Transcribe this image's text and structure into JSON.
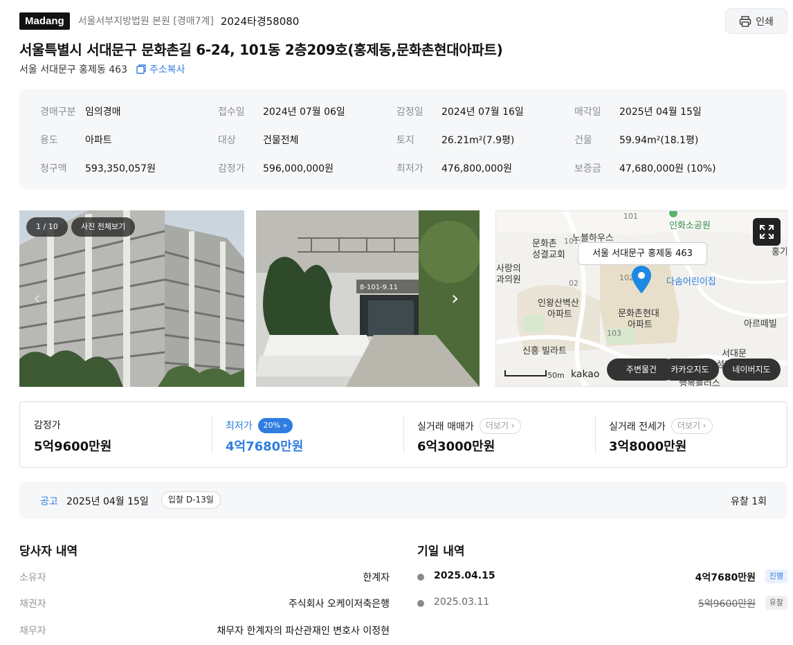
{
  "header": {
    "brand": "Madang",
    "court": "서울서부지방법원 본원 [경매7계]",
    "case_number": "2024타경58080",
    "print_label": "인쇄"
  },
  "address": {
    "full": "서울특별시 서대문구 문화촌길 6-24, 101동 2층209호(홍제동,문화촌현대아파트)",
    "lot": "서울 서대문구 홍제동 463",
    "copy_label": "주소복사"
  },
  "info": [
    {
      "label": "경매구분",
      "value": "임의경매"
    },
    {
      "label": "접수일",
      "value": "2024년 07월 06일"
    },
    {
      "label": "감정일",
      "value": "2024년 07월 16일"
    },
    {
      "label": "매각일",
      "value": "2025년 04월 15일"
    },
    {
      "label": "용도",
      "value": "아파트"
    },
    {
      "label": "대상",
      "value": "건물전체"
    },
    {
      "label": "토지",
      "value": "26.21m²(7.9평)"
    },
    {
      "label": "건물",
      "value": "59.94m²(18.1평)"
    },
    {
      "label": "청구액",
      "value": "593,350,057원"
    },
    {
      "label": "감정가",
      "value": "596,000,000원"
    },
    {
      "label": "최저가",
      "value": "476,800,000원"
    },
    {
      "label": "보증금",
      "value": "47,680,000원 (10%)"
    }
  ],
  "photos": {
    "counter": "1 / 10",
    "view_all": "사진 전체보기",
    "door_sign": "8-101-9.11"
  },
  "map": {
    "bubble": "서울 서대문구 홍제동 463",
    "labels": {
      "hall": "노블하우스",
      "church1": "문화촌",
      "church2": "성결교회",
      "clinic1": "사랑의",
      "clinic2": "과의원",
      "park": "인화소공원",
      "daycare": "다솜어린이집",
      "apt1a": "인왕산벽산",
      "apt1b": "아파트",
      "apt2a": "문화촌현대",
      "apt2b": "아파트",
      "villa": "신흥 빌라트",
      "arte": "아르떼빌",
      "seodaemun1": "서대문",
      "seodaemun2": "성지교회",
      "bottom1": "행복플러스",
      "hong": "홍기",
      "n101a": "101",
      "n101b": "101",
      "n102": "02",
      "n102b": "102",
      "n103": "103"
    },
    "scale": "50m",
    "logo": "kakao",
    "buttons": [
      "주변물건",
      "카카오지도",
      "네이버지도"
    ]
  },
  "prices": [
    {
      "label": "감정가",
      "value": "5억9600만원"
    },
    {
      "label": "최저가",
      "value": "4억7680만원",
      "chip": "20%"
    },
    {
      "label": "실거래 매매가",
      "value": "6억3000만원",
      "more": "더보기"
    },
    {
      "label": "실거래 전세가",
      "value": "3억8000만원",
      "more": "더보기"
    }
  ],
  "notice": {
    "label": "공고",
    "date": "2025년 04월 15일",
    "dday": "입찰 D-13일",
    "fail": "유찰 1회"
  },
  "parties": {
    "title": "당사자 내역",
    "rows": [
      {
        "label": "소유자",
        "value": "한계자"
      },
      {
        "label": "채권자",
        "value": "주식회사 오케이저축은행"
      },
      {
        "label": "채무자",
        "value": "채무자 한계자의 파산관재인 변호사 이정현"
      }
    ]
  },
  "history": {
    "title": "기일 내역",
    "rows": [
      {
        "date": "2025.04.15",
        "price": "4억7680만원",
        "status": "진행"
      },
      {
        "date": "2025.03.11",
        "price": "5억9600만원",
        "status": "유찰"
      }
    ]
  },
  "colors": {
    "accent": "#2f7de1",
    "panel": "#f6f7f9"
  }
}
